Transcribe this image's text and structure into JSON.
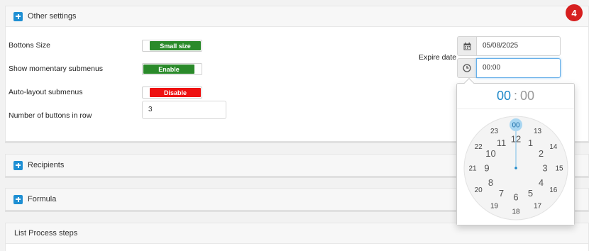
{
  "badge": "4",
  "panels": {
    "other": "Other settings",
    "recipients": "Recipients",
    "formula": "Formula",
    "list": "List Process steps"
  },
  "settings": {
    "buttons_size": {
      "label": "Bottons Size",
      "value": "Small size"
    },
    "momentary": {
      "label": "Show momentary submenus",
      "value": "Enable"
    },
    "autolayout": {
      "label": "Auto-layout submenus",
      "value": "Disable"
    },
    "buttons_in_row": {
      "label": "Number of buttons in row",
      "value": "3"
    }
  },
  "expire": {
    "label": "Expire date",
    "date": "05/08/2025",
    "time": "00:00"
  },
  "clock": {
    "hour": "00",
    "separator": ":",
    "minute": "00",
    "outer": [
      "00",
      "13",
      "14",
      "15",
      "16",
      "17",
      "18",
      "19",
      "20",
      "21",
      "22",
      "23"
    ],
    "inner": [
      "12",
      "1",
      "2",
      "3",
      "4",
      "5",
      "6",
      "7",
      "8",
      "9",
      "10",
      "11"
    ],
    "selected": "00"
  },
  "icons": {
    "calendar": "calendar-icon",
    "clock": "clock-icon",
    "plus": "plus-square-icon"
  },
  "colors": {
    "green": "#2a8a2a",
    "red": "#ee1111",
    "accent": "#1e88c8",
    "badge": "#d61f1f"
  }
}
